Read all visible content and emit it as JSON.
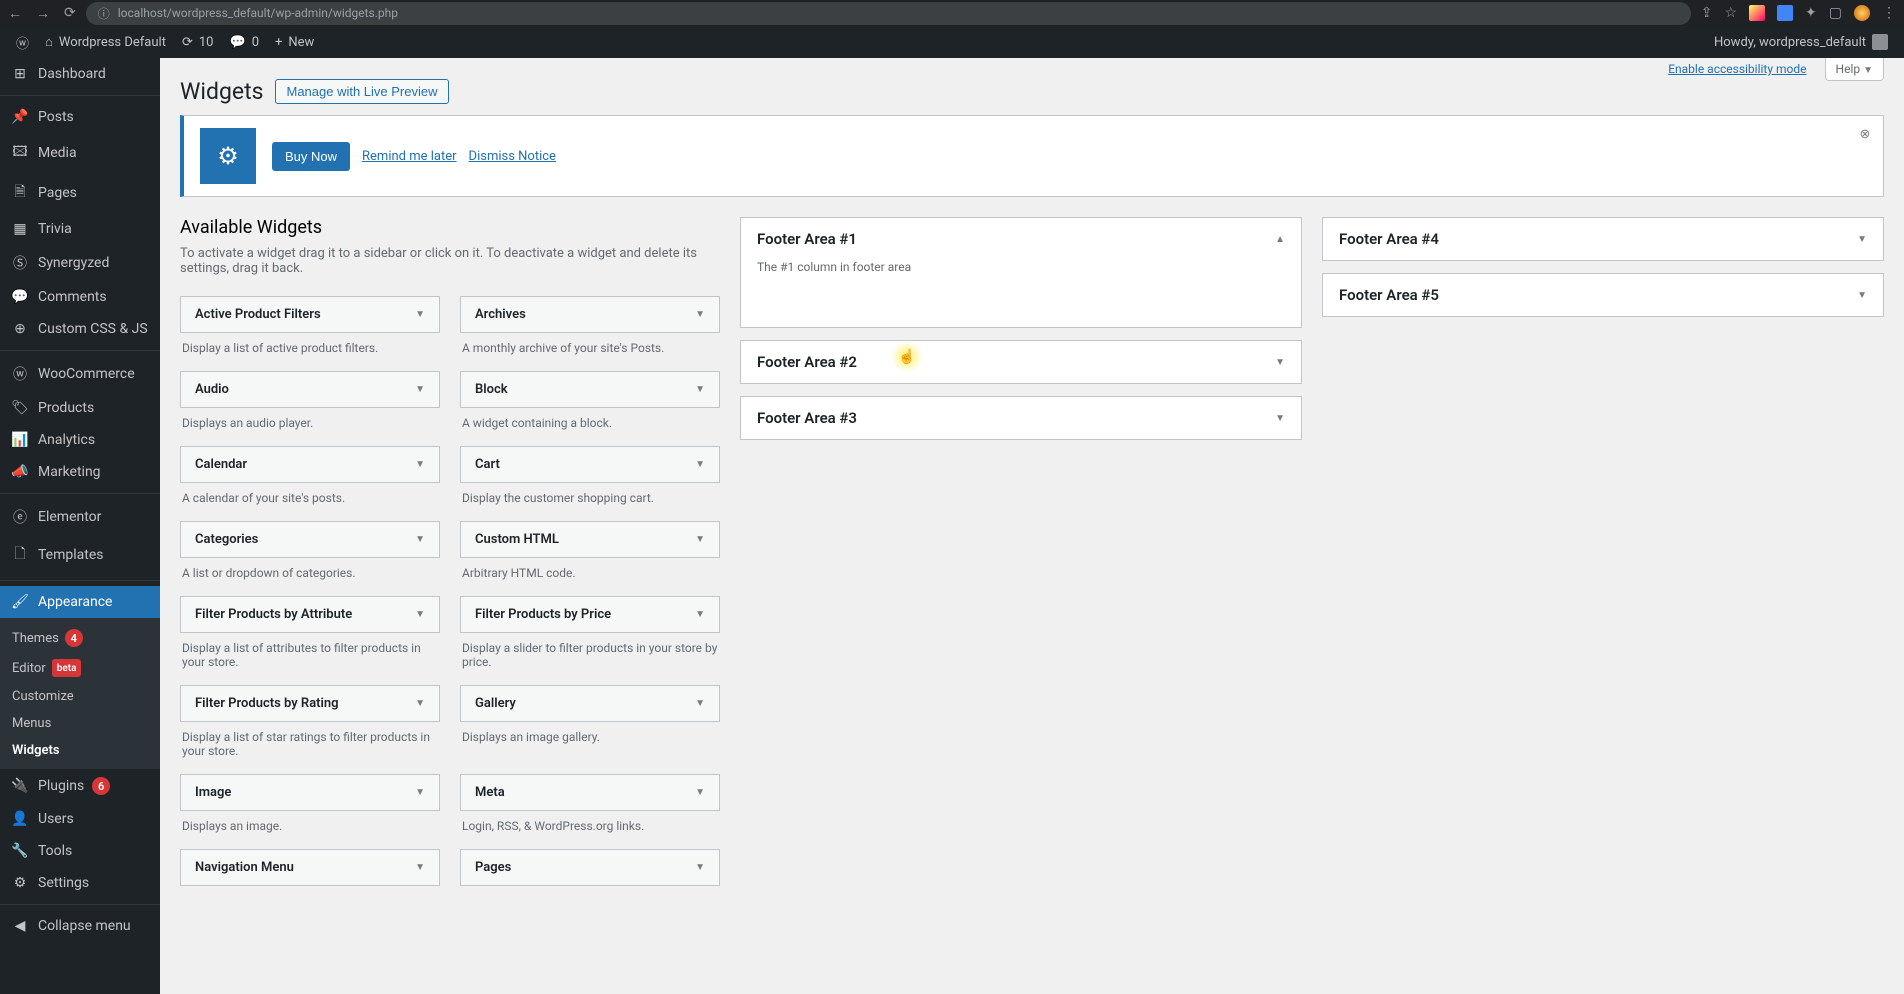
{
  "browser": {
    "url": "localhost/wordpress_default/wp-admin/widgets.php"
  },
  "adminbar": {
    "site_name": "Wordpress Default",
    "updates": "10",
    "comments": "0",
    "new": "New",
    "howdy": "Howdy, wordpress_default"
  },
  "sidebar": {
    "dashboard": "Dashboard",
    "posts": "Posts",
    "media": "Media",
    "pages": "Pages",
    "trivia": "Trivia",
    "synergyzed": "Synergyzed",
    "comments": "Comments",
    "custom_css": "Custom CSS & JS",
    "woocommerce": "WooCommerce",
    "products": "Products",
    "analytics": "Analytics",
    "marketing": "Marketing",
    "elementor": "Elementor",
    "templates": "Templates",
    "appearance": "Appearance",
    "themes": "Themes",
    "themes_count": "4",
    "editor": "Editor",
    "editor_badge": "beta",
    "customize": "Customize",
    "menus": "Menus",
    "widgets": "Widgets",
    "plugins": "Plugins",
    "plugins_count": "6",
    "users": "Users",
    "tools": "Tools",
    "settings": "Settings",
    "collapse": "Collapse menu"
  },
  "screen_meta": {
    "accessibility": "Enable accessibility mode",
    "help": "Help"
  },
  "page": {
    "title": "Widgets",
    "manage_btn": "Manage with Live Preview"
  },
  "notice": {
    "buy": "Buy Now",
    "remind": "Remind me later",
    "dismiss": "Dismiss Notice"
  },
  "available": {
    "heading": "Available Widgets",
    "description": "To activate a widget drag it to a sidebar or click on it. To deactivate a widget and delete its settings, drag it back.",
    "widgets": [
      {
        "title": "Active Product Filters",
        "desc": "Display a list of active product filters."
      },
      {
        "title": "Archives",
        "desc": "A monthly archive of your site's Posts."
      },
      {
        "title": "Audio",
        "desc": "Displays an audio player."
      },
      {
        "title": "Block",
        "desc": "A widget containing a block."
      },
      {
        "title": "Calendar",
        "desc": "A calendar of your site's posts."
      },
      {
        "title": "Cart",
        "desc": "Display the customer shopping cart."
      },
      {
        "title": "Categories",
        "desc": "A list or dropdown of categories."
      },
      {
        "title": "Custom HTML",
        "desc": "Arbitrary HTML code."
      },
      {
        "title": "Filter Products by Attribute",
        "desc": "Display a list of attributes to filter products in your store."
      },
      {
        "title": "Filter Products by Price",
        "desc": "Display a slider to filter products in your store by price."
      },
      {
        "title": "Filter Products by Rating",
        "desc": "Display a list of star ratings to filter products in your store."
      },
      {
        "title": "Gallery",
        "desc": "Displays an image gallery."
      },
      {
        "title": "Image",
        "desc": "Displays an image."
      },
      {
        "title": "Meta",
        "desc": "Login, RSS, & WordPress.org links."
      },
      {
        "title": "Navigation Menu",
        "desc": ""
      },
      {
        "title": "Pages",
        "desc": ""
      }
    ]
  },
  "areas_col1": [
    {
      "title": "Footer Area #1",
      "desc": "The #1 column in footer area",
      "expanded": true
    },
    {
      "title": "Footer Area #2",
      "expanded": false,
      "highlighted": true
    },
    {
      "title": "Footer Area #3",
      "expanded": false
    }
  ],
  "areas_col2": [
    {
      "title": "Footer Area #4",
      "expanded": false
    },
    {
      "title": "Footer Area #5",
      "expanded": false
    }
  ]
}
